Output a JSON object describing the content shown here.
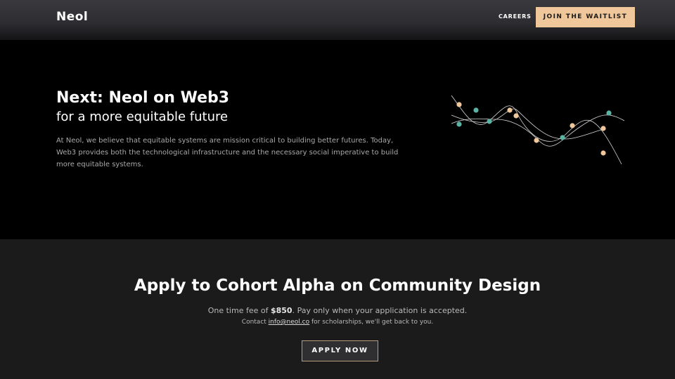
{
  "header": {
    "logo": "Neol",
    "nav_careers": "CAREERS",
    "waitlist_label": "JOIN THE WAITLIST"
  },
  "hero": {
    "title": "Next: Neol on Web3",
    "subtitle": "for a more equitable future",
    "body": "At Neol, we believe that equitable systems are mission critical to building better futures. Today, Web3 provides both the technological infrastructure and the necessary social imperative to build more equitable systems."
  },
  "apply": {
    "title": "Apply to Cohort Alpha on Community Design",
    "fee_prefix": "One time fee of ",
    "fee_amount": "$850",
    "fee_suffix": ". Pay only when your application is accepted.",
    "contact_prefix": "Contact ",
    "contact_email": "info@neol.co",
    "contact_suffix": " for scholarships, we'll get back to you.",
    "button_label": "APPLY NOW"
  },
  "colors": {
    "accent_peach": "#efc79a",
    "dot_teal": "#5bb3a4",
    "button_border": "#b69b7c"
  },
  "icons": {
    "hero_graphic": "network-curves-graphic"
  }
}
